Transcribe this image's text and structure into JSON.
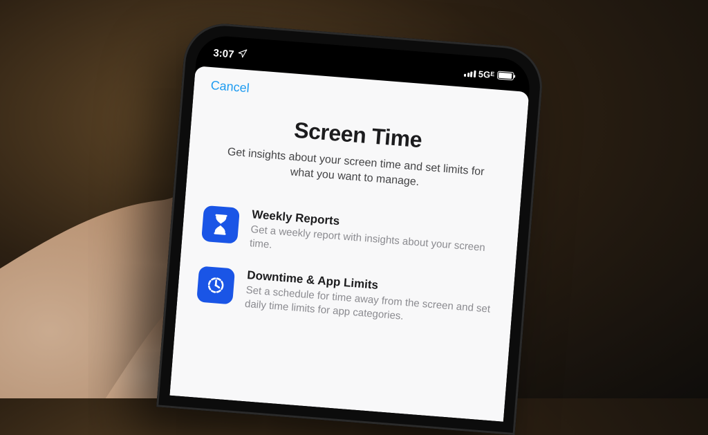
{
  "status_bar": {
    "time": "3:07",
    "network_label": "5G",
    "network_suffix": "E"
  },
  "sheet": {
    "cancel_label": "Cancel",
    "title": "Screen Time",
    "subtitle": "Get insights about your screen time and set limits for what you want to manage."
  },
  "features": [
    {
      "icon": "hourglass-icon",
      "title": "Weekly Reports",
      "desc": "Get a weekly report with insights about your screen time."
    },
    {
      "icon": "clock-progress-icon",
      "title": "Downtime & App Limits",
      "desc": "Set a schedule for time away from the screen and set daily time limits for app categories."
    }
  ]
}
